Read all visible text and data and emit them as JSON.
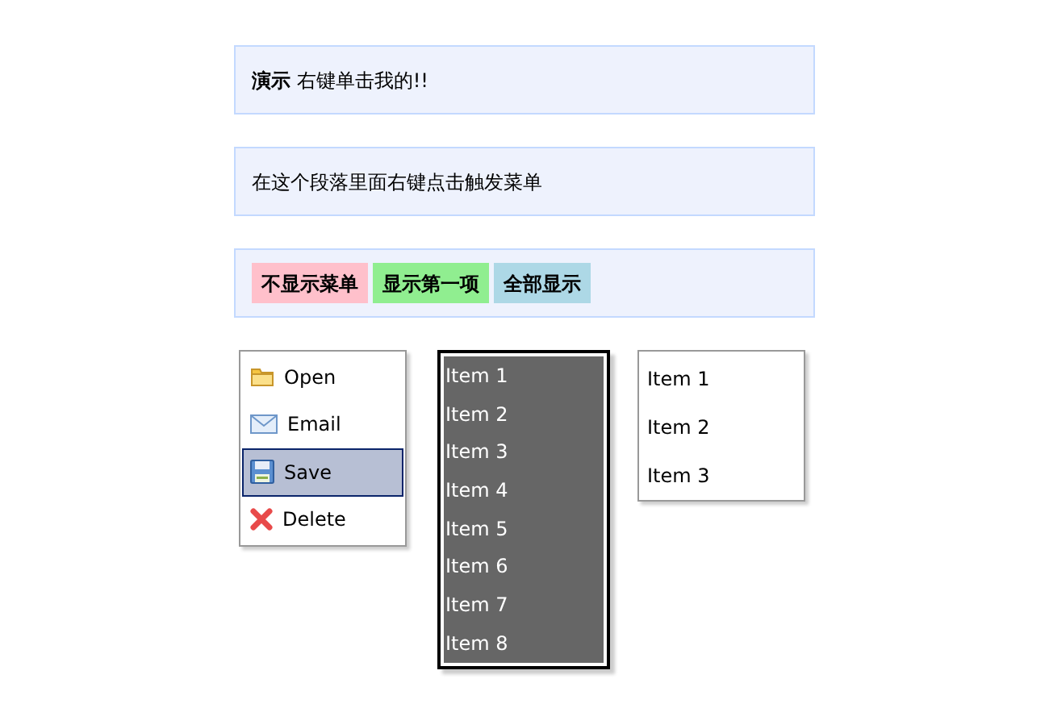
{
  "panels": [
    {
      "kind": "text",
      "text": "**演示** 右键单击我的!!"
    },
    {
      "kind": "text",
      "text": "在这个段落里面右键点击触发菜单"
    },
    {
      "kind": "buttons",
      "buttons": [
        {
          "label": "不显示菜单",
          "color": "#ffc0cb"
        },
        {
          "label": "显示第一项",
          "color": "#90ee90"
        },
        {
          "label": "全部显示",
          "color": "#add8e6"
        }
      ]
    }
  ],
  "icon_menu": {
    "items": [
      {
        "label": "Open",
        "selected": false
      },
      {
        "label": "Email",
        "selected": false
      },
      {
        "label": "Save",
        "selected": true
      },
      {
        "label": "Delete",
        "selected": false
      }
    ]
  },
  "dark_menu": {
    "items": [
      "Item 1",
      "Item 2",
      "Item 3",
      "Item 4",
      "Item 5",
      "Item 6",
      "Item 7",
      "Item 8"
    ]
  },
  "plain_menu": {
    "items": [
      "Item 1",
      "Item 2",
      "Item 3"
    ]
  }
}
